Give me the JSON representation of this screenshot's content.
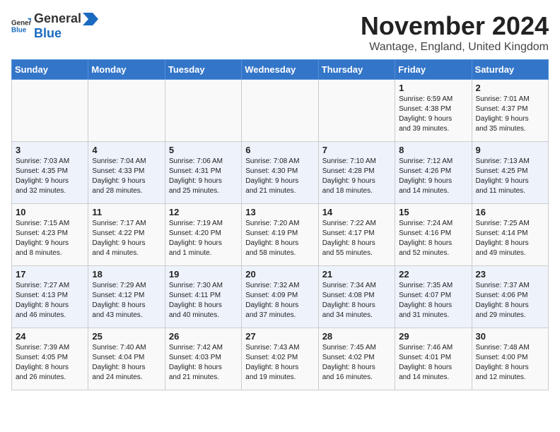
{
  "logo": {
    "text_general": "General",
    "text_blue": "Blue"
  },
  "header": {
    "month": "November 2024",
    "location": "Wantage, England, United Kingdom"
  },
  "weekdays": [
    "Sunday",
    "Monday",
    "Tuesday",
    "Wednesday",
    "Thursday",
    "Friday",
    "Saturday"
  ],
  "weeks": [
    [
      {
        "day": "",
        "info": ""
      },
      {
        "day": "",
        "info": ""
      },
      {
        "day": "",
        "info": ""
      },
      {
        "day": "",
        "info": ""
      },
      {
        "day": "",
        "info": ""
      },
      {
        "day": "1",
        "info": "Sunrise: 6:59 AM\nSunset: 4:38 PM\nDaylight: 9 hours\nand 39 minutes."
      },
      {
        "day": "2",
        "info": "Sunrise: 7:01 AM\nSunset: 4:37 PM\nDaylight: 9 hours\nand 35 minutes."
      }
    ],
    [
      {
        "day": "3",
        "info": "Sunrise: 7:03 AM\nSunset: 4:35 PM\nDaylight: 9 hours\nand 32 minutes."
      },
      {
        "day": "4",
        "info": "Sunrise: 7:04 AM\nSunset: 4:33 PM\nDaylight: 9 hours\nand 28 minutes."
      },
      {
        "day": "5",
        "info": "Sunrise: 7:06 AM\nSunset: 4:31 PM\nDaylight: 9 hours\nand 25 minutes."
      },
      {
        "day": "6",
        "info": "Sunrise: 7:08 AM\nSunset: 4:30 PM\nDaylight: 9 hours\nand 21 minutes."
      },
      {
        "day": "7",
        "info": "Sunrise: 7:10 AM\nSunset: 4:28 PM\nDaylight: 9 hours\nand 18 minutes."
      },
      {
        "day": "8",
        "info": "Sunrise: 7:12 AM\nSunset: 4:26 PM\nDaylight: 9 hours\nand 14 minutes."
      },
      {
        "day": "9",
        "info": "Sunrise: 7:13 AM\nSunset: 4:25 PM\nDaylight: 9 hours\nand 11 minutes."
      }
    ],
    [
      {
        "day": "10",
        "info": "Sunrise: 7:15 AM\nSunset: 4:23 PM\nDaylight: 9 hours\nand 8 minutes."
      },
      {
        "day": "11",
        "info": "Sunrise: 7:17 AM\nSunset: 4:22 PM\nDaylight: 9 hours\nand 4 minutes."
      },
      {
        "day": "12",
        "info": "Sunrise: 7:19 AM\nSunset: 4:20 PM\nDaylight: 9 hours\nand 1 minute."
      },
      {
        "day": "13",
        "info": "Sunrise: 7:20 AM\nSunset: 4:19 PM\nDaylight: 8 hours\nand 58 minutes."
      },
      {
        "day": "14",
        "info": "Sunrise: 7:22 AM\nSunset: 4:17 PM\nDaylight: 8 hours\nand 55 minutes."
      },
      {
        "day": "15",
        "info": "Sunrise: 7:24 AM\nSunset: 4:16 PM\nDaylight: 8 hours\nand 52 minutes."
      },
      {
        "day": "16",
        "info": "Sunrise: 7:25 AM\nSunset: 4:14 PM\nDaylight: 8 hours\nand 49 minutes."
      }
    ],
    [
      {
        "day": "17",
        "info": "Sunrise: 7:27 AM\nSunset: 4:13 PM\nDaylight: 8 hours\nand 46 minutes."
      },
      {
        "day": "18",
        "info": "Sunrise: 7:29 AM\nSunset: 4:12 PM\nDaylight: 8 hours\nand 43 minutes."
      },
      {
        "day": "19",
        "info": "Sunrise: 7:30 AM\nSunset: 4:11 PM\nDaylight: 8 hours\nand 40 minutes."
      },
      {
        "day": "20",
        "info": "Sunrise: 7:32 AM\nSunset: 4:09 PM\nDaylight: 8 hours\nand 37 minutes."
      },
      {
        "day": "21",
        "info": "Sunrise: 7:34 AM\nSunset: 4:08 PM\nDaylight: 8 hours\nand 34 minutes."
      },
      {
        "day": "22",
        "info": "Sunrise: 7:35 AM\nSunset: 4:07 PM\nDaylight: 8 hours\nand 31 minutes."
      },
      {
        "day": "23",
        "info": "Sunrise: 7:37 AM\nSunset: 4:06 PM\nDaylight: 8 hours\nand 29 minutes."
      }
    ],
    [
      {
        "day": "24",
        "info": "Sunrise: 7:39 AM\nSunset: 4:05 PM\nDaylight: 8 hours\nand 26 minutes."
      },
      {
        "day": "25",
        "info": "Sunrise: 7:40 AM\nSunset: 4:04 PM\nDaylight: 8 hours\nand 24 minutes."
      },
      {
        "day": "26",
        "info": "Sunrise: 7:42 AM\nSunset: 4:03 PM\nDaylight: 8 hours\nand 21 minutes."
      },
      {
        "day": "27",
        "info": "Sunrise: 7:43 AM\nSunset: 4:02 PM\nDaylight: 8 hours\nand 19 minutes."
      },
      {
        "day": "28",
        "info": "Sunrise: 7:45 AM\nSunset: 4:02 PM\nDaylight: 8 hours\nand 16 minutes."
      },
      {
        "day": "29",
        "info": "Sunrise: 7:46 AM\nSunset: 4:01 PM\nDaylight: 8 hours\nand 14 minutes."
      },
      {
        "day": "30",
        "info": "Sunrise: 7:48 AM\nSunset: 4:00 PM\nDaylight: 8 hours\nand 12 minutes."
      }
    ]
  ]
}
